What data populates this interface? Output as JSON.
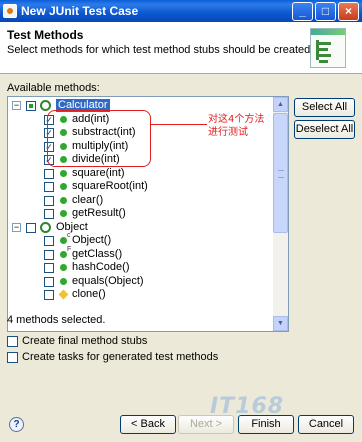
{
  "window": {
    "title": "New JUnit Test Case",
    "controls": [
      "_",
      "□",
      "×"
    ]
  },
  "header": {
    "title": "Test Methods",
    "description": "Select methods for which test method stubs should be created."
  },
  "tree": {
    "label": "Available methods:",
    "rows": [
      {
        "text": "Calculator",
        "level": 0,
        "twisty": "−",
        "checked": "partial",
        "icon": "class-icon",
        "selected": true
      },
      {
        "text": "add(int)",
        "level": 1,
        "checked": true,
        "icon": "public-method-icon"
      },
      {
        "text": "substract(int)",
        "level": 1,
        "checked": true,
        "icon": "public-method-icon"
      },
      {
        "text": "multiply(int)",
        "level": 1,
        "checked": true,
        "icon": "public-method-icon"
      },
      {
        "text": "divide(int)",
        "level": 1,
        "checked": true,
        "icon": "public-method-icon"
      },
      {
        "text": "square(int)",
        "level": 1,
        "checked": false,
        "icon": "public-method-icon"
      },
      {
        "text": "squareRoot(int)",
        "level": 1,
        "checked": false,
        "icon": "public-method-icon"
      },
      {
        "text": "clear()",
        "level": 1,
        "checked": false,
        "icon": "public-method-icon"
      },
      {
        "text": "getResult()",
        "level": 1,
        "checked": false,
        "icon": "public-method-icon"
      },
      {
        "text": "Object",
        "level": 0,
        "twisty": "−",
        "checked": false,
        "icon": "class-icon"
      },
      {
        "text": "Object()",
        "level": 1,
        "checked": false,
        "icon": "constructor-icon",
        "sup": "c"
      },
      {
        "text": "getClass()",
        "level": 1,
        "checked": false,
        "icon": "final-method-icon",
        "sup": "F"
      },
      {
        "text": "hashCode()",
        "level": 1,
        "checked": false,
        "icon": "public-method-icon"
      },
      {
        "text": "equals(Object)",
        "level": 1,
        "checked": false,
        "icon": "public-method-icon"
      },
      {
        "text": "clone()",
        "level": 1,
        "checked": false,
        "icon": "protected-method-icon"
      }
    ]
  },
  "annotation": {
    "line1": "对这4个方法",
    "line2": "进行测试"
  },
  "side_buttons": {
    "select_all": "Select All",
    "deselect_all": "Deselect All"
  },
  "status": "4 methods selected.",
  "options": [
    {
      "label": "Create final method stubs",
      "checked": false
    },
    {
      "label": "Create tasks for generated test methods",
      "checked": false
    }
  ],
  "footer": {
    "help": "?",
    "back": "< Back",
    "next": "Next >",
    "finish": "Finish",
    "cancel": "Cancel"
  },
  "watermark": "IT168",
  "colors": {
    "selection": "#316ac5",
    "annotation": "#e02020",
    "method_icon": "#2fa82f"
  }
}
